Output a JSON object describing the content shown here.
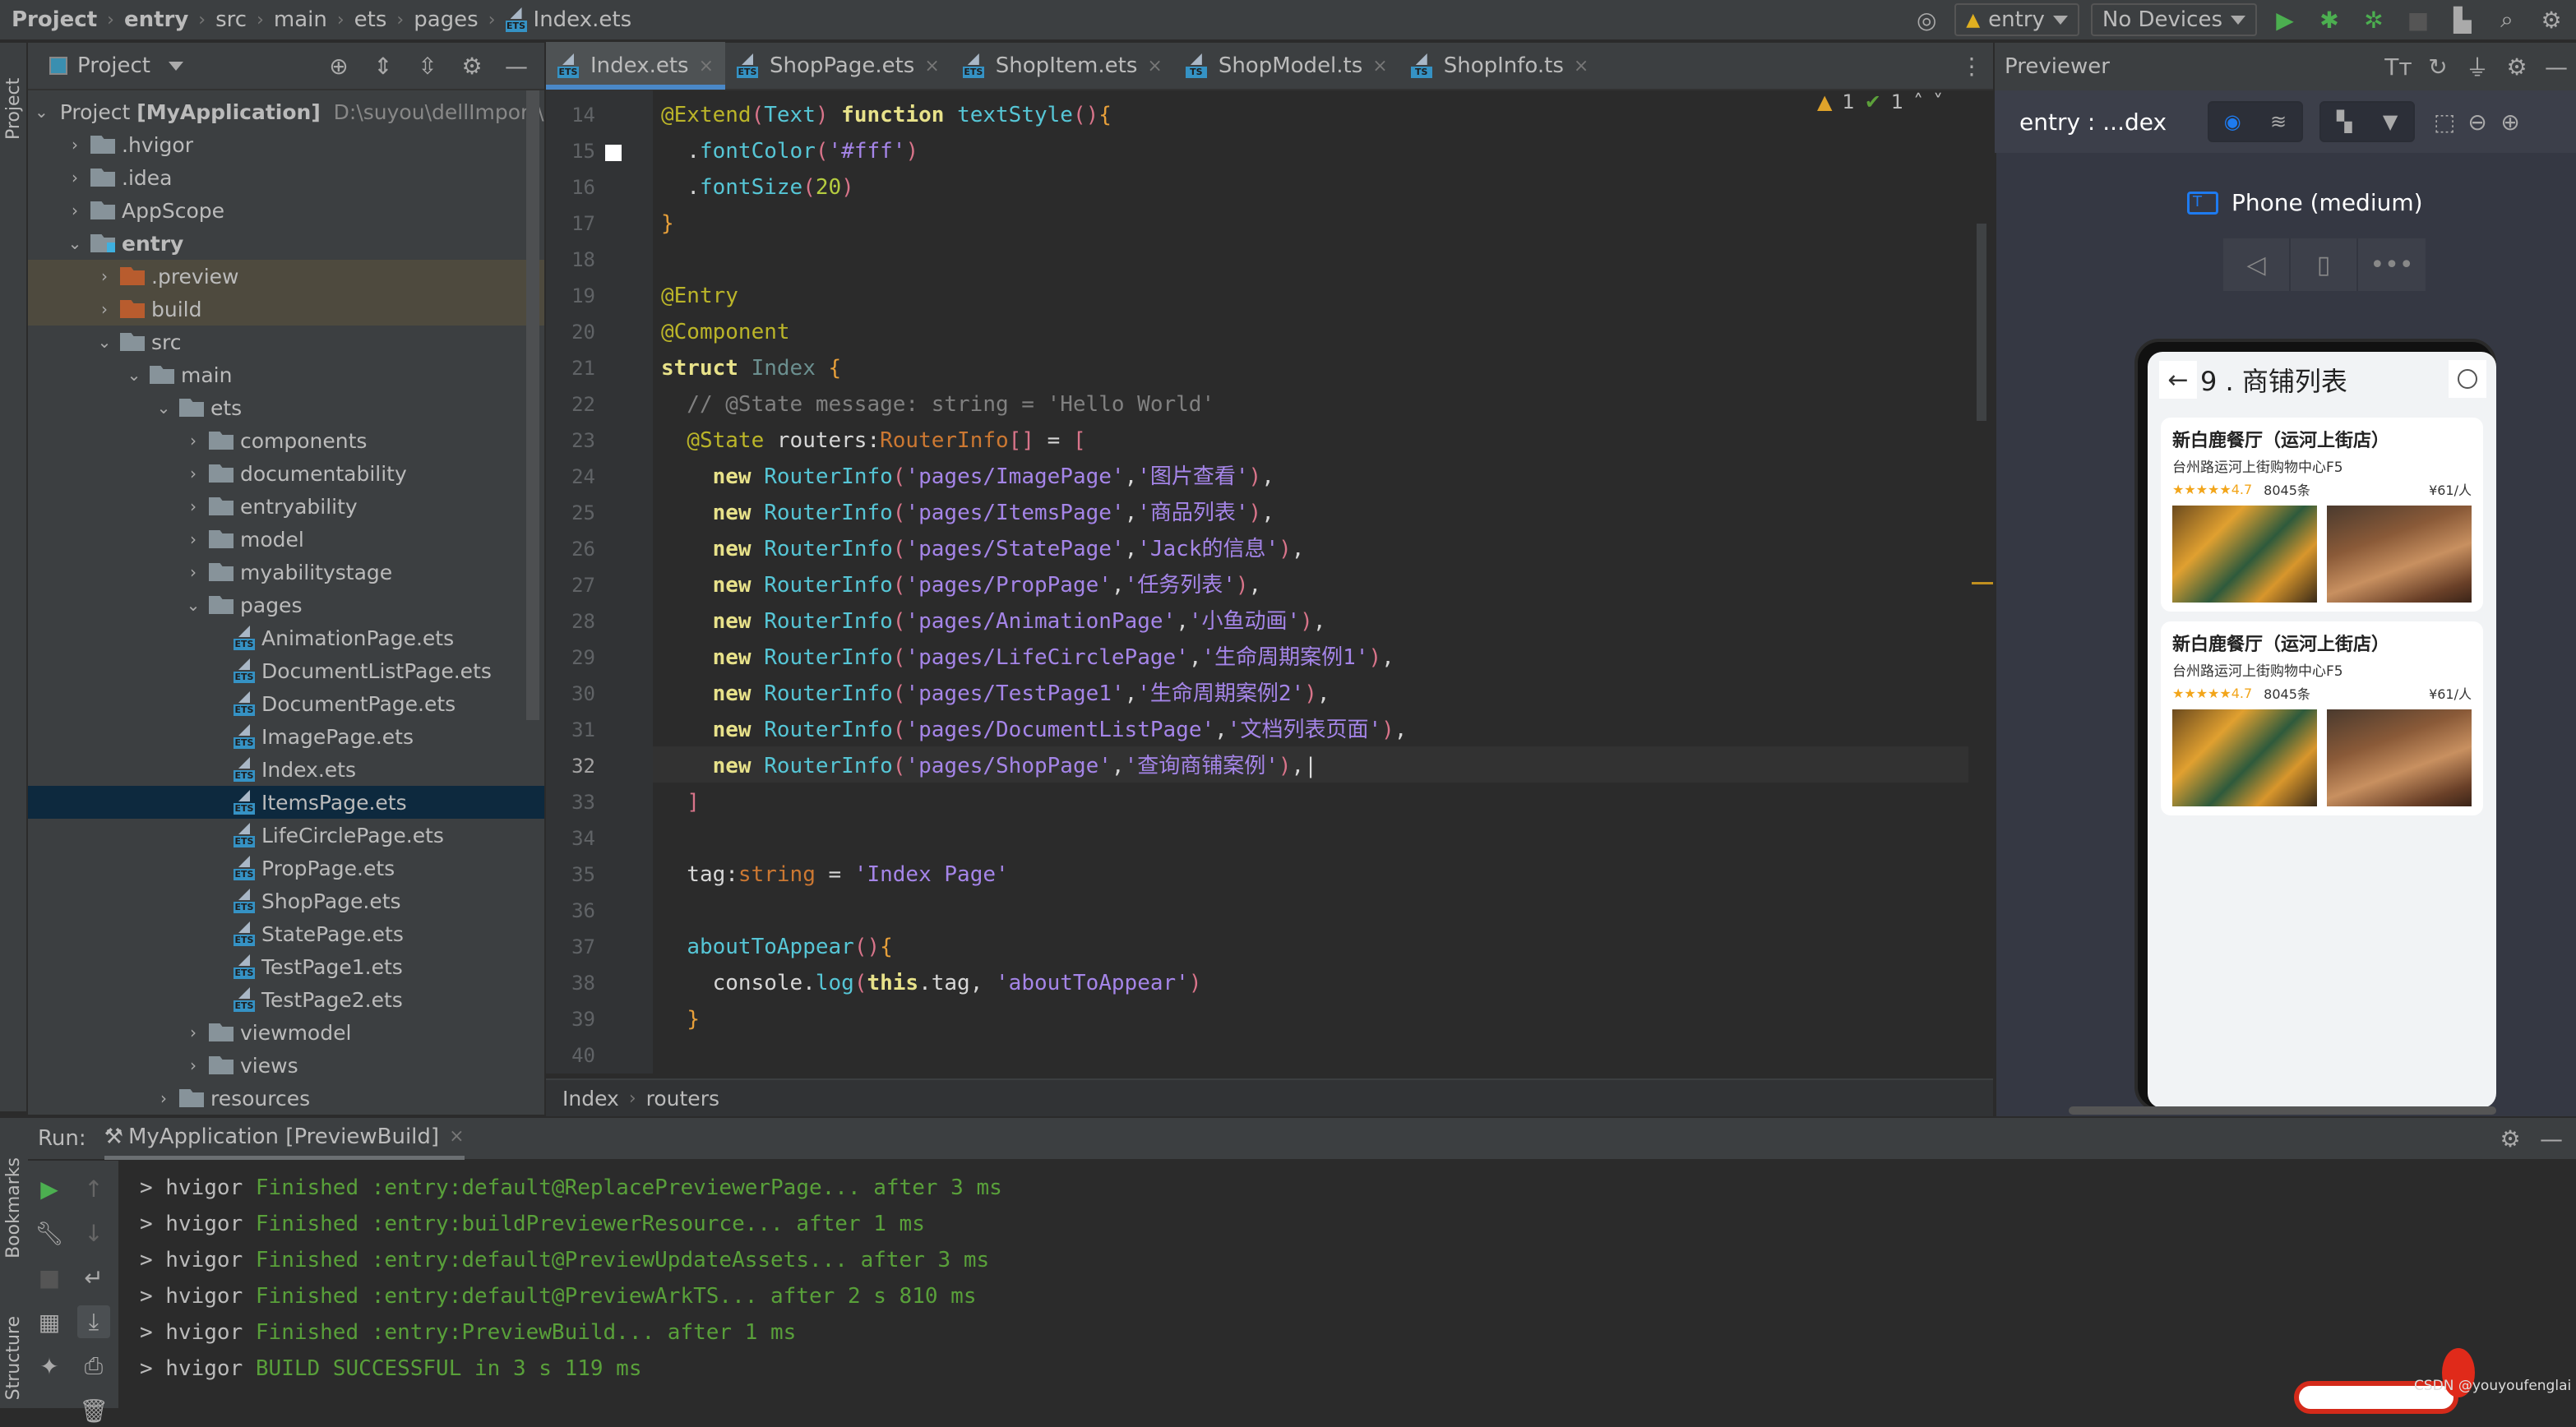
{
  "breadcrumb": [
    "Project",
    "entry",
    "src",
    "main",
    "ets",
    "pages",
    "Index.ets"
  ],
  "toolbar": {
    "module": "entry",
    "device": "No Devices"
  },
  "project_panel": {
    "title": "Project",
    "root_label": "Project",
    "root_name": "[MyApplication]",
    "root_path": "D:\\suyou\\dellImport\\i"
  },
  "tree": [
    {
      "label": ".hvigor",
      "level": 1,
      "type": "folder",
      "state": "collapsed"
    },
    {
      "label": ".idea",
      "level": 1,
      "type": "folder",
      "state": "collapsed"
    },
    {
      "label": "AppScope",
      "level": 1,
      "type": "folder",
      "state": "collapsed"
    },
    {
      "label": "entry",
      "level": 1,
      "type": "module",
      "state": "expanded"
    },
    {
      "label": ".preview",
      "level": 2,
      "type": "folder-excluded",
      "state": "collapsed"
    },
    {
      "label": "build",
      "level": 2,
      "type": "folder-excluded",
      "state": "collapsed"
    },
    {
      "label": "src",
      "level": 2,
      "type": "folder",
      "state": "expanded"
    },
    {
      "label": "main",
      "level": 3,
      "type": "folder",
      "state": "expanded"
    },
    {
      "label": "ets",
      "level": 4,
      "type": "folder",
      "state": "expanded"
    },
    {
      "label": "components",
      "level": 5,
      "type": "folder",
      "state": "collapsed"
    },
    {
      "label": "documentability",
      "level": 5,
      "type": "folder",
      "state": "collapsed"
    },
    {
      "label": "entryability",
      "level": 5,
      "type": "folder",
      "state": "collapsed"
    },
    {
      "label": "model",
      "level": 5,
      "type": "folder",
      "state": "collapsed"
    },
    {
      "label": "myabilitystage",
      "level": 5,
      "type": "folder",
      "state": "collapsed"
    },
    {
      "label": "pages",
      "level": 5,
      "type": "folder",
      "state": "expanded"
    },
    {
      "label": "AnimationPage.ets",
      "level": 6,
      "type": "ets"
    },
    {
      "label": "DocumentListPage.ets",
      "level": 6,
      "type": "ets"
    },
    {
      "label": "DocumentPage.ets",
      "level": 6,
      "type": "ets"
    },
    {
      "label": "ImagePage.ets",
      "level": 6,
      "type": "ets"
    },
    {
      "label": "Index.ets",
      "level": 6,
      "type": "ets"
    },
    {
      "label": "ItemsPage.ets",
      "level": 6,
      "type": "ets",
      "selected": true
    },
    {
      "label": "LifeCirclePage.ets",
      "level": 6,
      "type": "ets"
    },
    {
      "label": "PropPage.ets",
      "level": 6,
      "type": "ets"
    },
    {
      "label": "ShopPage.ets",
      "level": 6,
      "type": "ets"
    },
    {
      "label": "StatePage.ets",
      "level": 6,
      "type": "ets"
    },
    {
      "label": "TestPage1.ets",
      "level": 6,
      "type": "ets"
    },
    {
      "label": "TestPage2.ets",
      "level": 6,
      "type": "ets"
    },
    {
      "label": "viewmodel",
      "level": 5,
      "type": "folder",
      "state": "collapsed"
    },
    {
      "label": "views",
      "level": 5,
      "type": "folder",
      "state": "collapsed"
    },
    {
      "label": "resources",
      "level": 4,
      "type": "folder",
      "state": "collapsed"
    }
  ],
  "tabs": [
    {
      "label": "Index.ets",
      "kind": "ETS",
      "active": true
    },
    {
      "label": "ShopPage.ets",
      "kind": "ETS"
    },
    {
      "label": "ShopItem.ets",
      "kind": "ETS"
    },
    {
      "label": "ShopModel.ts",
      "kind": "TS"
    },
    {
      "label": "ShopInfo.ts",
      "kind": "TS"
    }
  ],
  "inspections": {
    "warnings": "1",
    "weak_warnings": "1"
  },
  "code": {
    "current_line": 32,
    "lines": [
      {
        "n": 14,
        "html": [
          [
            "an",
            "@Extend"
          ],
          [
            "p",
            "("
          ],
          [
            "fn",
            "Text"
          ],
          [
            "p",
            ")"
          ],
          [
            "wt",
            " "
          ],
          [
            "k",
            "function"
          ],
          [
            "wt",
            " "
          ],
          [
            "fn",
            "textStyle"
          ],
          [
            "p",
            "()"
          ],
          [
            "br",
            "{"
          ]
        ]
      },
      {
        "n": 15,
        "html": [
          [
            "wt",
            "  "
          ],
          [
            "wt",
            "."
          ],
          [
            "fn",
            "fontColor"
          ],
          [
            "p",
            "("
          ],
          [
            "s",
            "'#fff'"
          ],
          [
            "p",
            ")"
          ]
        ]
      },
      {
        "n": 16,
        "html": [
          [
            "wt",
            "  "
          ],
          [
            "wt",
            "."
          ],
          [
            "fn",
            "fontSize"
          ],
          [
            "p",
            "("
          ],
          [
            "nm",
            "20"
          ],
          [
            "p",
            ")"
          ]
        ]
      },
      {
        "n": 17,
        "html": [
          [
            "br",
            "}"
          ]
        ]
      },
      {
        "n": 18,
        "html": []
      },
      {
        "n": 19,
        "html": [
          [
            "an",
            "@Entry"
          ]
        ]
      },
      {
        "n": 20,
        "html": [
          [
            "an",
            "@Component"
          ]
        ]
      },
      {
        "n": 21,
        "html": [
          [
            "k",
            "struct"
          ],
          [
            "wt",
            " "
          ],
          [
            "idx",
            "Index"
          ],
          [
            "wt",
            " "
          ],
          [
            "br",
            "{"
          ]
        ]
      },
      {
        "n": 22,
        "html": [
          [
            "cm",
            "  // @State message: string = 'Hello World'"
          ]
        ]
      },
      {
        "n": 23,
        "html": [
          [
            "wt",
            "  "
          ],
          [
            "an",
            "@State"
          ],
          [
            "wt",
            " routers:"
          ],
          [
            "ty",
            "RouterInfo"
          ],
          [
            "p",
            "[]"
          ],
          [
            "wt",
            " = "
          ],
          [
            "p",
            "["
          ]
        ]
      },
      {
        "n": 24,
        "html": [
          [
            "wt",
            "    "
          ],
          [
            "k",
            "new"
          ],
          [
            "wt",
            " "
          ],
          [
            "fn",
            "RouterInfo"
          ],
          [
            "p",
            "("
          ],
          [
            "s",
            "'pages/ImagePage'"
          ],
          [
            "wt",
            ","
          ],
          [
            "s",
            "'图片查看'"
          ],
          [
            "p",
            ")"
          ],
          [
            "wt",
            ","
          ]
        ]
      },
      {
        "n": 25,
        "html": [
          [
            "wt",
            "    "
          ],
          [
            "k",
            "new"
          ],
          [
            "wt",
            " "
          ],
          [
            "fn",
            "RouterInfo"
          ],
          [
            "p",
            "("
          ],
          [
            "s",
            "'pages/ItemsPage'"
          ],
          [
            "wt",
            ","
          ],
          [
            "s",
            "'商品列表'"
          ],
          [
            "p",
            ")"
          ],
          [
            "wt",
            ","
          ]
        ]
      },
      {
        "n": 26,
        "html": [
          [
            "wt",
            "    "
          ],
          [
            "k",
            "new"
          ],
          [
            "wt",
            " "
          ],
          [
            "fn",
            "RouterInfo"
          ],
          [
            "p",
            "("
          ],
          [
            "s",
            "'pages/StatePage'"
          ],
          [
            "wt",
            ","
          ],
          [
            "s",
            "'Jack的信息'"
          ],
          [
            "p",
            ")"
          ],
          [
            "wt",
            ","
          ]
        ]
      },
      {
        "n": 27,
        "html": [
          [
            "wt",
            "    "
          ],
          [
            "k",
            "new"
          ],
          [
            "wt",
            " "
          ],
          [
            "fn",
            "RouterInfo"
          ],
          [
            "p",
            "("
          ],
          [
            "s",
            "'pages/PropPage'"
          ],
          [
            "wt",
            ","
          ],
          [
            "s",
            "'任务列表'"
          ],
          [
            "p",
            ")"
          ],
          [
            "wt",
            ","
          ]
        ]
      },
      {
        "n": 28,
        "html": [
          [
            "wt",
            "    "
          ],
          [
            "k",
            "new"
          ],
          [
            "wt",
            " "
          ],
          [
            "fn",
            "RouterInfo"
          ],
          [
            "p",
            "("
          ],
          [
            "s",
            "'pages/AnimationPage'"
          ],
          [
            "wt",
            ","
          ],
          [
            "s",
            "'小鱼动画'"
          ],
          [
            "p",
            ")"
          ],
          [
            "wt",
            ","
          ]
        ]
      },
      {
        "n": 29,
        "html": [
          [
            "wt",
            "    "
          ],
          [
            "k",
            "new"
          ],
          [
            "wt",
            " "
          ],
          [
            "fn",
            "RouterInfo"
          ],
          [
            "p",
            "("
          ],
          [
            "s",
            "'pages/LifeCirclePage'"
          ],
          [
            "wt",
            ","
          ],
          [
            "s",
            "'生命周期案例1'"
          ],
          [
            "p",
            ")"
          ],
          [
            "wt",
            ","
          ]
        ]
      },
      {
        "n": 30,
        "html": [
          [
            "wt",
            "    "
          ],
          [
            "k",
            "new"
          ],
          [
            "wt",
            " "
          ],
          [
            "fn",
            "RouterInfo"
          ],
          [
            "p",
            "("
          ],
          [
            "s",
            "'pages/TestPage1'"
          ],
          [
            "wt",
            ","
          ],
          [
            "s",
            "'生命周期案例2'"
          ],
          [
            "p",
            ")"
          ],
          [
            "wt",
            ","
          ]
        ]
      },
      {
        "n": 31,
        "html": [
          [
            "wt",
            "    "
          ],
          [
            "k",
            "new"
          ],
          [
            "wt",
            " "
          ],
          [
            "fn",
            "RouterInfo"
          ],
          [
            "p",
            "("
          ],
          [
            "s",
            "'pages/DocumentListPage'"
          ],
          [
            "wt",
            ","
          ],
          [
            "s",
            "'文档列表页面'"
          ],
          [
            "p",
            ")"
          ],
          [
            "wt",
            ","
          ]
        ]
      },
      {
        "n": 32,
        "html": [
          [
            "wt",
            "    "
          ],
          [
            "k",
            "new"
          ],
          [
            "wt",
            " "
          ],
          [
            "fn",
            "RouterInfo"
          ],
          [
            "p",
            "("
          ],
          [
            "s",
            "'pages/ShopPage'"
          ],
          [
            "wt",
            ","
          ],
          [
            "s",
            "'查询商铺案例'"
          ],
          [
            "p",
            ")"
          ],
          [
            "wt",
            ","
          ]
        ]
      },
      {
        "n": 33,
        "html": [
          [
            "wt",
            "  "
          ],
          [
            "p",
            "]"
          ]
        ]
      },
      {
        "n": 34,
        "html": []
      },
      {
        "n": 35,
        "html": [
          [
            "wt",
            "  tag:"
          ],
          [
            "ty",
            "string"
          ],
          [
            "wt",
            " = "
          ],
          [
            "s",
            "'Index Page'"
          ]
        ]
      },
      {
        "n": 36,
        "html": []
      },
      {
        "n": 37,
        "html": [
          [
            "wt",
            "  "
          ],
          [
            "fn",
            "aboutToAppear"
          ],
          [
            "p",
            "()"
          ],
          [
            "br",
            "{"
          ]
        ]
      },
      {
        "n": 38,
        "html": [
          [
            "wt",
            "    console."
          ],
          [
            "fn",
            "log"
          ],
          [
            "p",
            "("
          ],
          [
            "k",
            "this"
          ],
          [
            "wt",
            ".tag, "
          ],
          [
            "s",
            "'aboutToAppear'"
          ],
          [
            "p",
            ")"
          ]
        ]
      },
      {
        "n": 39,
        "html": [
          [
            "wt",
            "  "
          ],
          [
            "br",
            "}"
          ]
        ]
      },
      {
        "n": 40,
        "html": []
      }
    ]
  },
  "editor_breadcrumb": [
    "Index",
    "routers"
  ],
  "previewer": {
    "title": "Previewer",
    "target": "entry : ...dex",
    "device": "Phone (medium)",
    "app": {
      "title": "9 . 商铺列表",
      "shops": [
        {
          "name": "新白鹿餐厅（运河上街店）",
          "address": "台州路运河上街购物中心F5",
          "stars": "★★★★★",
          "rating": "4.7",
          "reviews": "8045条",
          "price": "¥61/人"
        },
        {
          "name": "新白鹿餐厅（运河上街店）",
          "address": "台州路运河上街购物中心F5",
          "stars": "★★★★★",
          "rating": "4.7",
          "reviews": "8045条",
          "price": "¥61/人"
        }
      ]
    }
  },
  "run": {
    "label": "Run:",
    "config": "MyApplication [PreviewBuild]",
    "lines": [
      {
        "prefix": "> hvigor ",
        "msg": "Finished :entry:default@ReplacePreviewerPage... after 3 ms"
      },
      {
        "prefix": "> hvigor ",
        "msg": "Finished :entry:buildPreviewerResource... after 1 ms"
      },
      {
        "prefix": "> hvigor ",
        "msg": "Finished :entry:default@PreviewUpdateAssets... after 3 ms"
      },
      {
        "prefix": "> hvigor ",
        "msg": "Finished :entry:default@PreviewArkTS... after 2 s 810 ms"
      },
      {
        "prefix": "> hvigor ",
        "msg": "Finished :entry:PreviewBuild... after 1 ms"
      },
      {
        "prefix": "> hvigor ",
        "msg": "BUILD SUCCESSFUL in 3 s 119 ms"
      }
    ]
  },
  "side_labels": {
    "project": "Project",
    "bookmarks": "Bookmarks",
    "structure": "Structure"
  },
  "watermark": "CSDN @youyoufenglai"
}
